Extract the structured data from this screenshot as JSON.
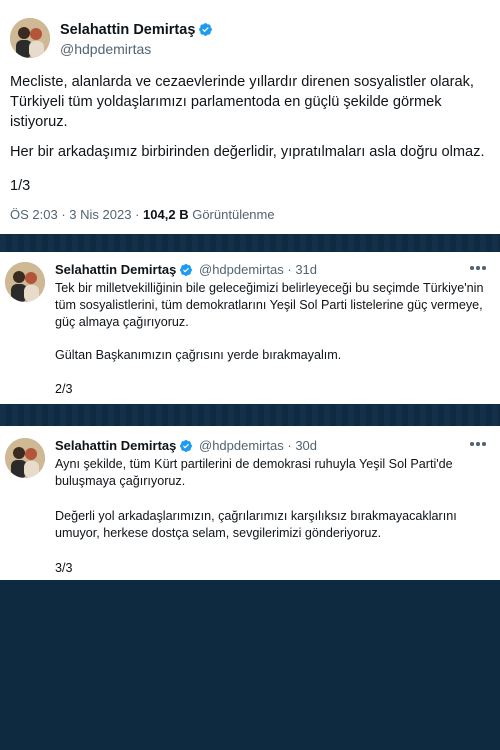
{
  "tweets": [
    {
      "name": "Selahattin Demirtaş",
      "handle": "@hdpdemirtas",
      "paragraphs": [
        "Mecliste, alanlarda ve cezaevlerinde yıllardır direnen sosyalistler olarak, Türkiyeli tüm yoldaşlarımızı parlamentoda en güçlü şekilde görmek istiyoruz.",
        "Her bir arkadaşımız birbirinden değerlidir, yıpratılmaları asla doğru olmaz.",
        "1/3"
      ],
      "time": "ÖS 2:03",
      "date": "3 Nis 2023",
      "views": "104,2 B",
      "views_label": "Görüntülenme"
    },
    {
      "name": "Selahattin Demirtaş",
      "handle": "@hdpdemirtas",
      "age": "31d",
      "paragraphs": [
        "Tek bir milletvekilliğinin bile geleceğimizi belirleyeceği bu seçimde Türkiye'nin tüm sosyalistlerini, tüm demokratlarını Yeşil Sol Parti listelerine güç vermeye, güç almaya çağırıyoruz.",
        "Gültan Başkanımızın çağrısını yerde bırakmayalım.",
        "2/3"
      ]
    },
    {
      "name": "Selahattin Demirtaş",
      "handle": "@hdpdemirtas",
      "age": "30d",
      "paragraphs": [
        "Aynı şekilde, tüm Kürt partilerini de demokrasi ruhuyla Yeşil Sol Parti'de buluşmaya çağırıyoruz.",
        "Değerli yol arkadaşlarımızın, çağrılarımızı karşılıksız bırakmayacaklarını umuyor, herkese dostça selam, sevgilerimizi gönderiyoruz.",
        "3/3"
      ]
    }
  ],
  "colors": {
    "verified": "#1d9bf0",
    "background": "#0d2a40",
    "secondary_text": "#536471"
  },
  "icons": {
    "verified": "verified-badge-icon",
    "more": "more-dots-icon"
  }
}
